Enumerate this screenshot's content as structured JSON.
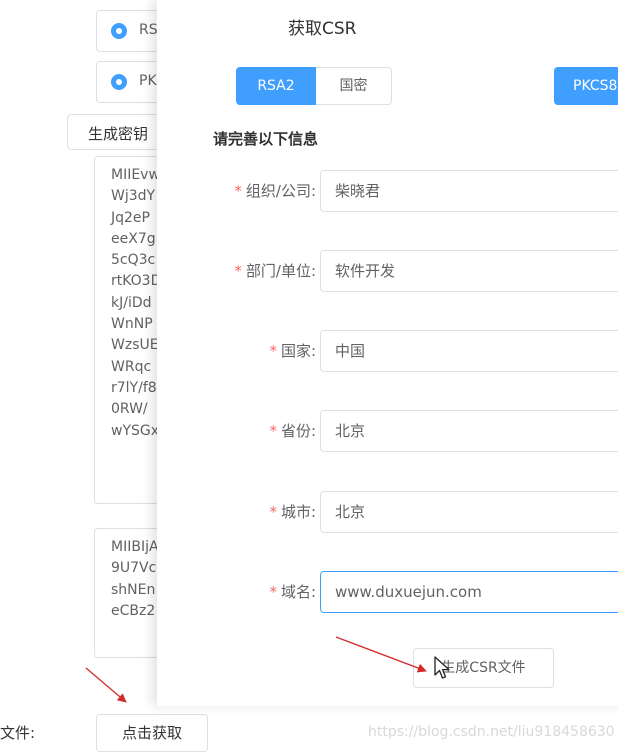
{
  "background": {
    "radio_algorithm_label": "RS",
    "radio_format_label": "PK",
    "generate_key_button": "生成密钥",
    "private_key_lines": [
      "MIIEvw",
      "Wj3dY",
      "Jq2eP",
      "eeX7g",
      "5cQ3c",
      "rtKO3D",
      "kJ/iDd",
      "WnNP",
      "WzsUE",
      "WRqc",
      "r7lY/f8",
      "0RW/",
      "wYSGx"
    ],
    "public_key_lines": [
      "MIIBIjA",
      "9U7Vc",
      "shNEn",
      "eCBz2"
    ],
    "file_label": "文件:",
    "fetch_button": "点击获取",
    "watermark": "https://blog.csdn.net/liu918458630"
  },
  "dialog": {
    "title": "获取CSR",
    "tabs": {
      "rsa2": "RSA2",
      "guomi": "国密",
      "pkcs": "PKCS8"
    },
    "section_title": "请完善以下信息",
    "fields": [
      {
        "label": "组织/公司:",
        "value": "柴晓君"
      },
      {
        "label": "部门/单位:",
        "value": "软件开发"
      },
      {
        "label": "国家:",
        "value": "中国"
      },
      {
        "label": "省份:",
        "value": "北京"
      },
      {
        "label": "城市:",
        "value": "北京"
      },
      {
        "label": "域名:",
        "value": "www.duxuejun.com"
      }
    ],
    "required_mark": "*",
    "generate_button": "生成CSR文件"
  },
  "colors": {
    "primary": "#409eff",
    "required": "#f56c6c",
    "arrow": "#d42a2a"
  },
  "icons": [
    "radio-checked-icon",
    "mouse-cursor-icon"
  ]
}
